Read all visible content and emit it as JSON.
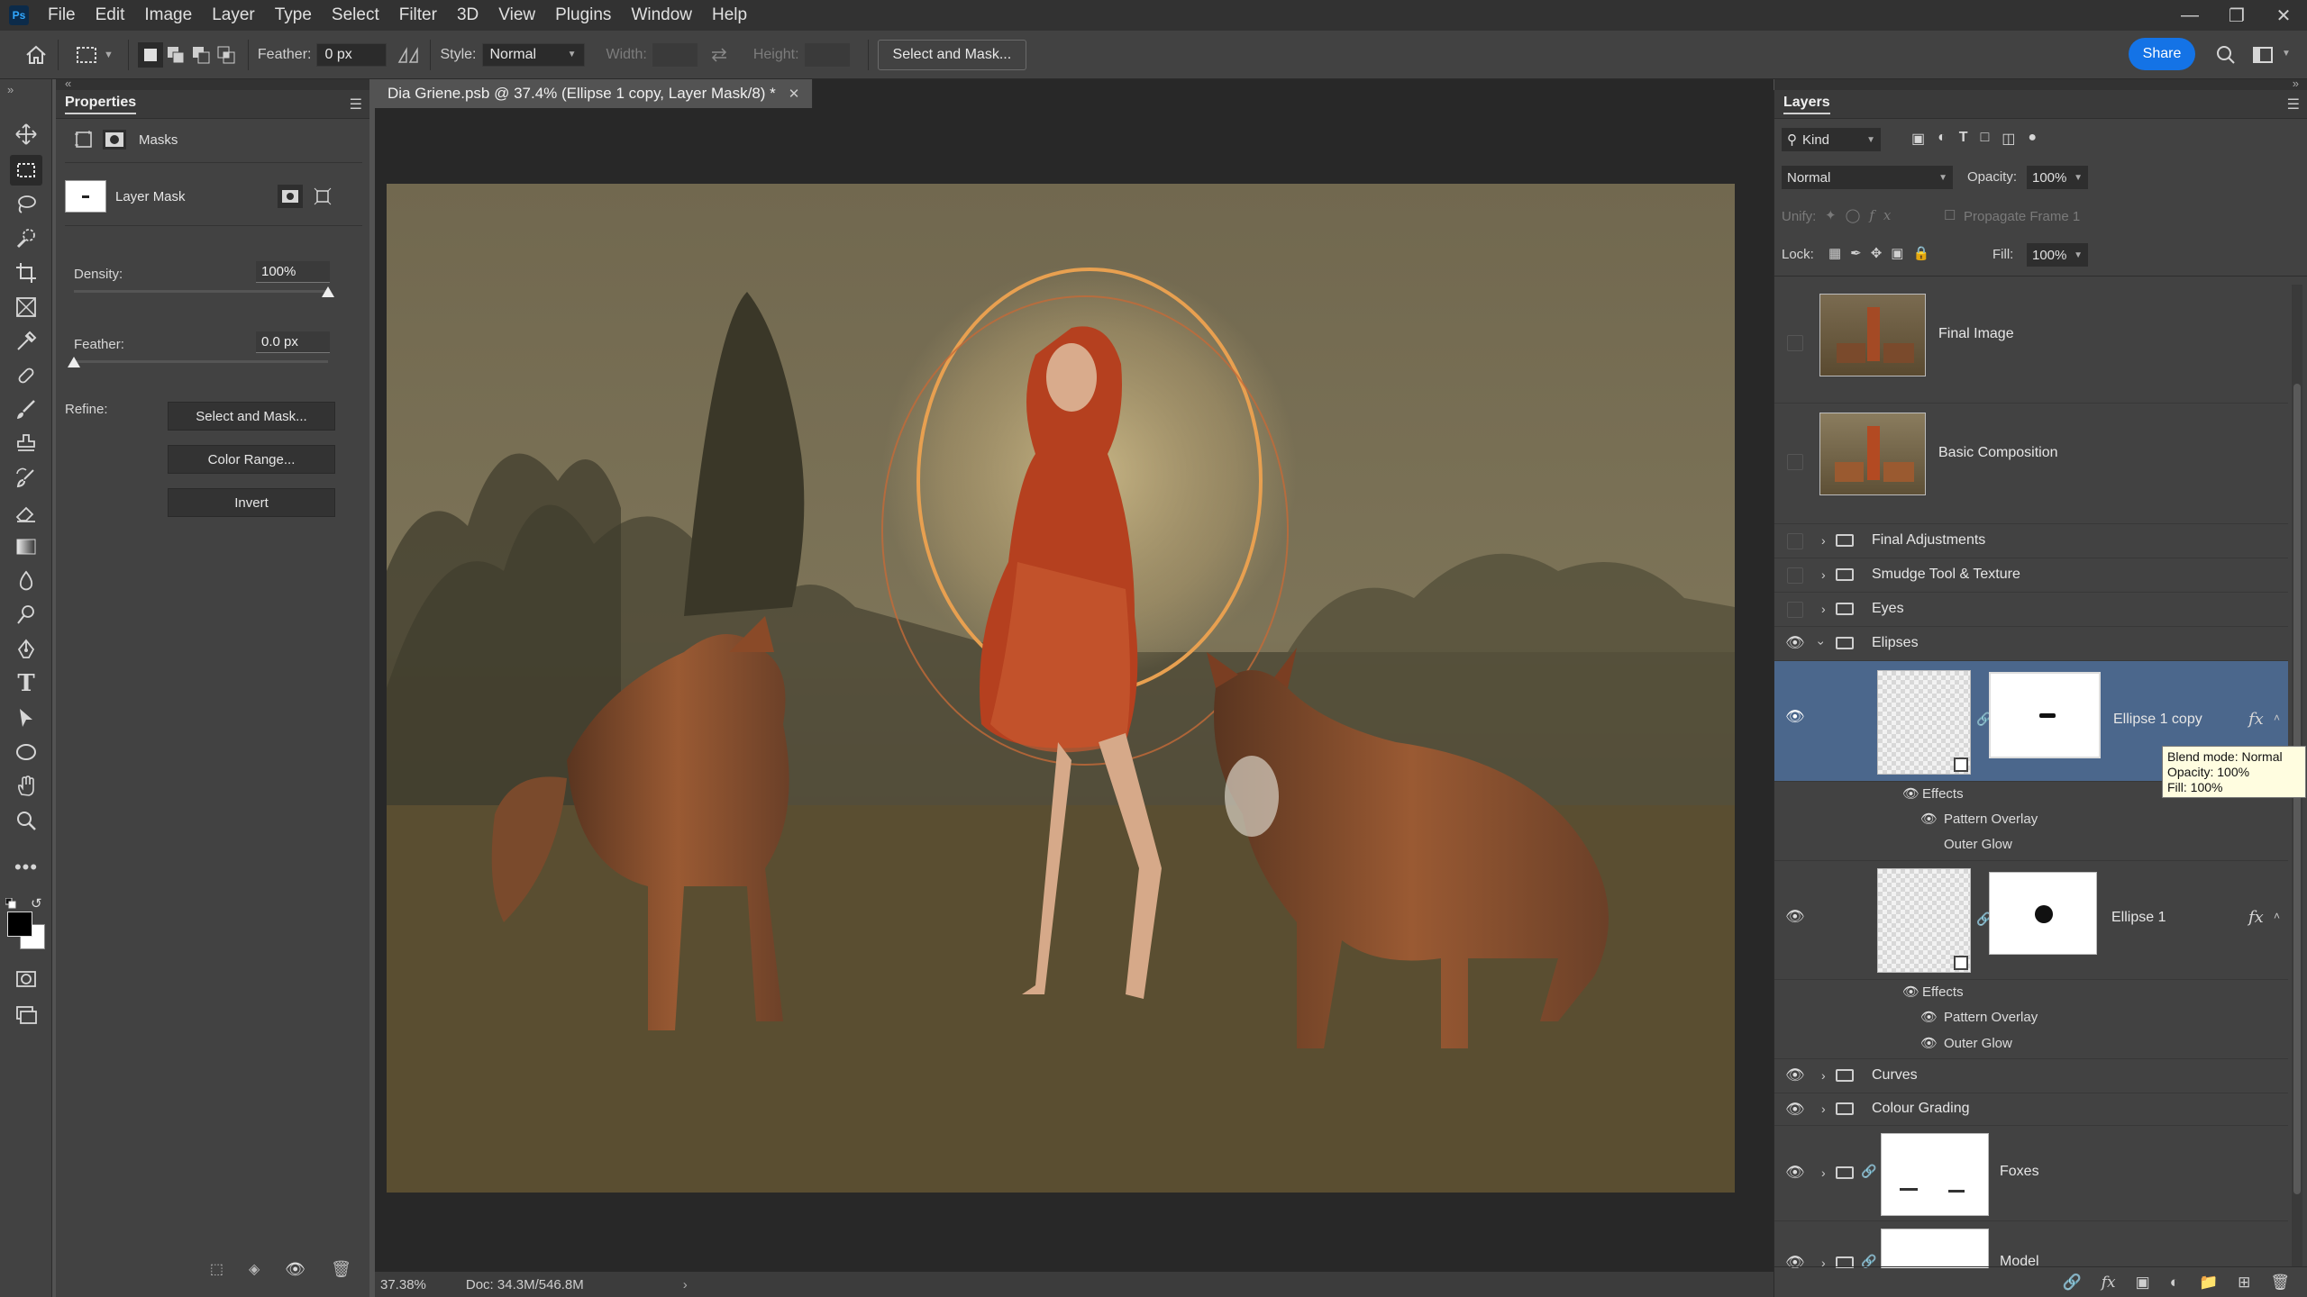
{
  "menu": [
    "File",
    "Edit",
    "Image",
    "Layer",
    "Type",
    "Select",
    "Filter",
    "3D",
    "View",
    "Plugins",
    "Window",
    "Help"
  ],
  "ps_logo": "Ps",
  "options": {
    "feather_label": "Feather:",
    "feather_value": "0 px",
    "style_label": "Style:",
    "style_value": "Normal",
    "width_label": "Width:",
    "height_label": "Height:",
    "select_mask": "Select and Mask...",
    "share": "Share"
  },
  "properties": {
    "title": "Properties",
    "tab": "Masks",
    "mask_label": "Layer Mask",
    "density_label": "Density:",
    "density_value": "100%",
    "density_level": 1.0,
    "feather_label": "Feather:",
    "feather_value": "0.0 px",
    "feather_level": 0.0,
    "refine_label": "Refine:",
    "select_mask": "Select and Mask...",
    "color_range": "Color Range...",
    "invert": "Invert"
  },
  "document": {
    "tab_title": "Dia Griene.psb @ 37.4% (Ellipse 1 copy, Layer Mask/8) *",
    "zoom": "37.38%",
    "doc_size": "Doc: 34.3M/546.8M"
  },
  "layers": {
    "title": "Layers",
    "kind": "Kind",
    "blend": "Normal",
    "opacity_label": "Opacity:",
    "opacity": "100%",
    "unify_label": "Unify:",
    "propagate": "Propagate Frame 1",
    "lock_label": "Lock:",
    "fill_label": "Fill:",
    "fill": "100%",
    "items": {
      "final_image": "Final Image",
      "basic_comp": "Basic Composition",
      "final_adj": "Final Adjustments",
      "smudge": "Smudge Tool & Texture",
      "eyes": "Eyes",
      "elipses": "Elipses",
      "ellipse1copy": "Ellipse 1 copy",
      "effects": "Effects",
      "pattern_overlay": "Pattern Overlay",
      "outer_glow": "Outer Glow",
      "ellipse1": "Ellipse 1",
      "curves": "Curves",
      "colour_grading": "Colour Grading",
      "foxes": "Foxes",
      "model": "Model"
    },
    "tooltip": {
      "line1": "Blend mode: Normal",
      "line2": "Opacity: 100%",
      "line3": "Fill: 100%"
    },
    "fx": "fx"
  },
  "colors": {
    "accent": "#1473e6",
    "selected_layer": "#4b678c",
    "panel": "#424242",
    "canvas_bg": "#282828"
  }
}
